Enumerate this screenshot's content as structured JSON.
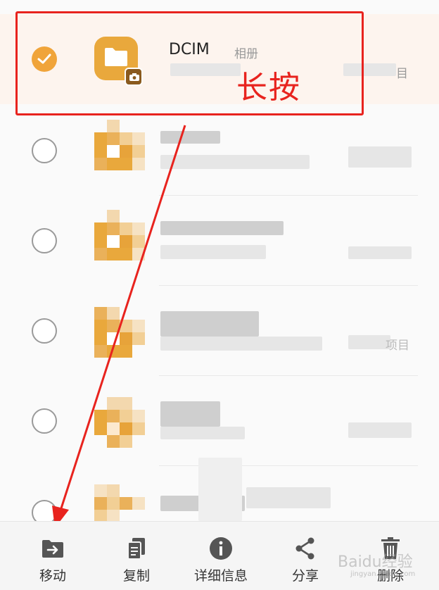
{
  "selected_item": {
    "name": "DCIM",
    "tag": "相册",
    "partial_meta": "目",
    "checked": true
  },
  "other_rows": [
    {
      "checked": false,
      "partial_meta": ""
    },
    {
      "checked": false,
      "partial_meta": ""
    },
    {
      "checked": false,
      "partial_meta": "项目"
    },
    {
      "checked": false,
      "partial_meta": ""
    },
    {
      "checked": false,
      "partial_meta": ""
    }
  ],
  "annotation": {
    "text": "长按",
    "color": "#e8231e"
  },
  "toolbar": {
    "move": "移动",
    "copy": "复制",
    "details": "详细信息",
    "share": "分享",
    "delete": "删除"
  },
  "watermark": {
    "text": "Baidu经验",
    "sub": "jingyan.baidu.com"
  },
  "colors": {
    "accent": "#f0a43a",
    "folder": "#e9a83c",
    "annotation": "#e8231e"
  }
}
